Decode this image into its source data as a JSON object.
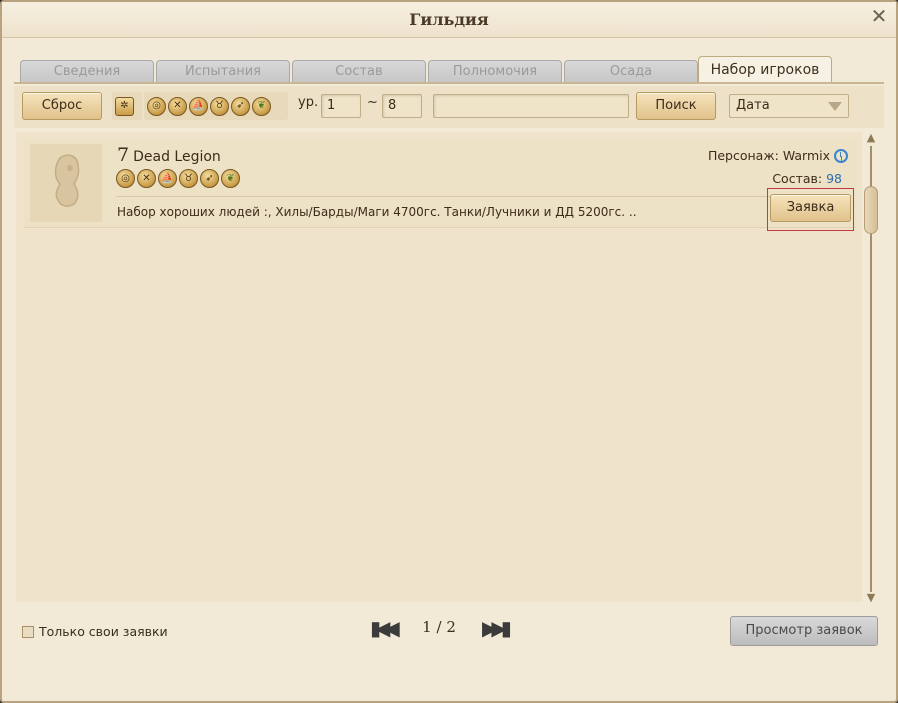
{
  "window": {
    "title": "Гильдия",
    "close_symbol": "✕"
  },
  "tabs": [
    {
      "label": "Сведения",
      "active": false
    },
    {
      "label": "Испытания",
      "active": false
    },
    {
      "label": "Состав",
      "active": false
    },
    {
      "label": "Полномочия",
      "active": false
    },
    {
      "label": "Осада",
      "active": false
    },
    {
      "label": "Набор игроков",
      "active": true
    }
  ],
  "filter": {
    "reset_label": "Сброс",
    "settings_icon": "gear-icon",
    "class_icons": [
      "target-icon",
      "crossed-swords-icon",
      "ship-icon",
      "mask-icon",
      "horn-icon",
      "sprout-icon"
    ],
    "level_label": "ур.",
    "level_min": "1",
    "level_separator": "~",
    "level_max": "8",
    "search_text": "",
    "search_label": "Поиск",
    "sort_value": "Дата"
  },
  "guilds": [
    {
      "level": "7",
      "name": "Dead Legion",
      "leader_label": "Персонаж:",
      "leader_name": "Warmix",
      "members_label": "Состав:",
      "members": "98",
      "description": "Набор хороших людей :, Хилы/Барды/Маги 4700гс. Танки/Лучники и ДД 5200гс. ..",
      "apply_label": "Заявка"
    }
  ],
  "footer": {
    "own_only_label": "Только свои заявки",
    "page_current": "1",
    "page_separator": "/",
    "page_total": "2",
    "view_requests_label": "Просмотр заявок"
  },
  "colors": {
    "background": "#f2e9d6",
    "gold_button": "#e0c28a",
    "highlight_border": "#c23a46",
    "members_value": "#2f6db0"
  }
}
